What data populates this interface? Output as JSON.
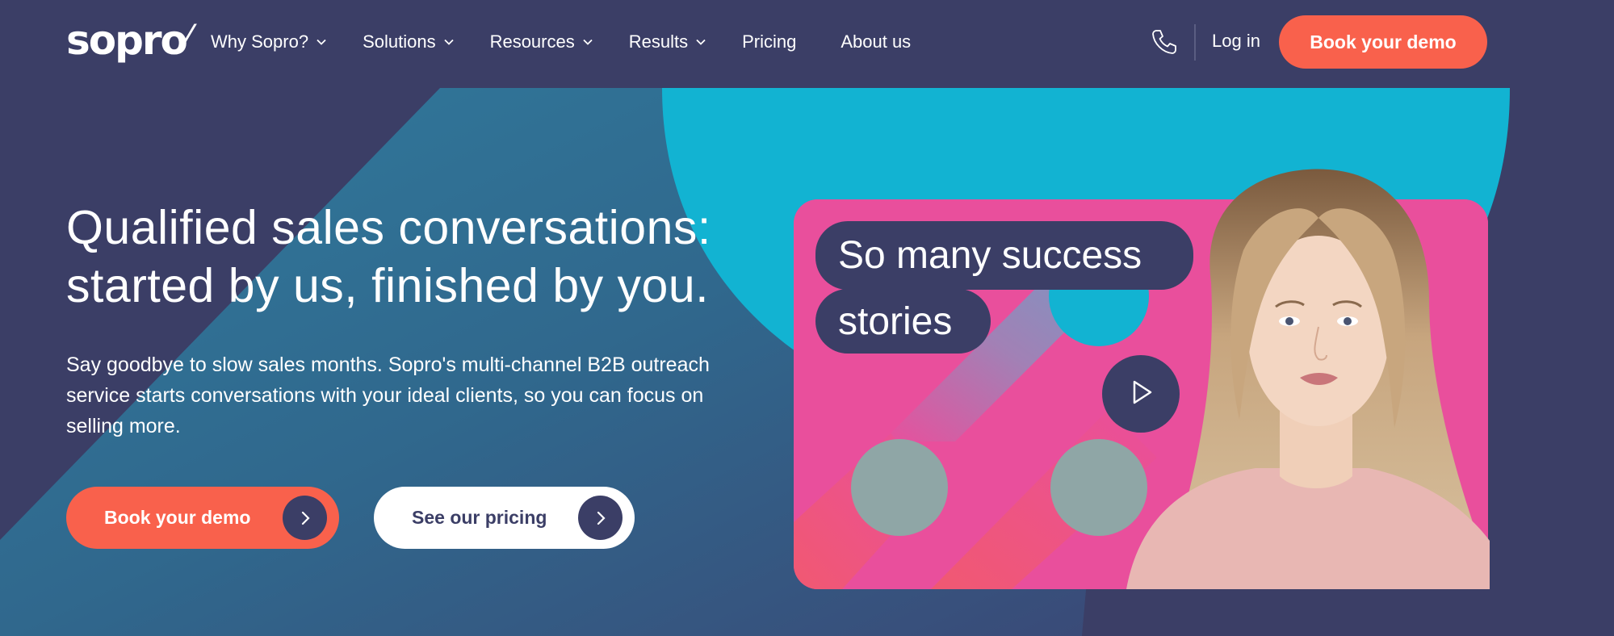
{
  "header": {
    "logo_text": "sopro",
    "nav": [
      {
        "label": "Why Sopro?",
        "has_dropdown": true
      },
      {
        "label": "Solutions",
        "has_dropdown": true
      },
      {
        "label": "Resources",
        "has_dropdown": true
      },
      {
        "label": "Results",
        "has_dropdown": true
      },
      {
        "label": "Pricing",
        "has_dropdown": false
      },
      {
        "label": "About us",
        "has_dropdown": false
      }
    ],
    "phone_icon": "phone-icon",
    "login_label": "Log in",
    "cta_label": "Book your demo"
  },
  "hero": {
    "headline_line1": "Qualified sales conversations:",
    "headline_line2": "started by us, finished by you.",
    "subtext": "Say goodbye to slow sales months. Sopro's multi-channel B2B outreach service starts conversations with your ideal clients, so you can focus on selling more.",
    "primary_button": "Book your demo",
    "secondary_button": "See our pricing"
  },
  "video": {
    "caption_line1": "So many success",
    "caption_line2": "stories",
    "play_icon": "play-icon"
  },
  "colors": {
    "navy": "#3b3e66",
    "coral": "#f9614c",
    "cyan": "#12b3d2",
    "pink": "#e94f9c",
    "white": "#ffffff"
  }
}
